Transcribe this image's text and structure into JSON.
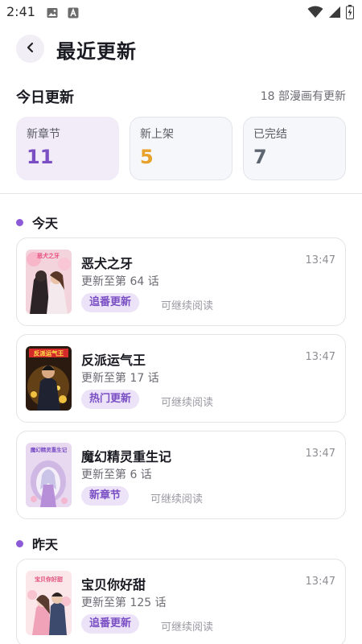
{
  "status_bar": {
    "time": "2:41"
  },
  "header": {
    "title": "最近更新"
  },
  "summary": {
    "title": "今日更新",
    "note": "18 部漫画有更新",
    "stats": [
      {
        "label": "新章节",
        "value": "11",
        "color": "#7a4fc4"
      },
      {
        "label": "新上架",
        "value": "5",
        "color": "#e8a12a"
      },
      {
        "label": "已完结",
        "value": "7",
        "color": "#5f6672"
      }
    ]
  },
  "sections": [
    {
      "day": "今天",
      "items": [
        {
          "title": "恶犬之牙",
          "time": "13:47",
          "progress": "更新至第 64 话",
          "tag": "追番更新",
          "hint": "可继续阅读"
        },
        {
          "title": "反派运气王",
          "time": "13:47",
          "progress": "更新至第 17 话",
          "tag": "热门更新",
          "hint": "可继续阅读"
        },
        {
          "title": "魔幻精灵重生记",
          "time": "13:47",
          "progress": "更新至第 6 话",
          "tag": "新章节",
          "hint": "可继续阅读"
        }
      ]
    },
    {
      "day": "昨天",
      "items": [
        {
          "title": "宝贝你好甜",
          "time": "13:47",
          "progress": "更新至第 125 话",
          "tag": "追番更新",
          "hint": "可继续阅读"
        }
      ]
    }
  ]
}
